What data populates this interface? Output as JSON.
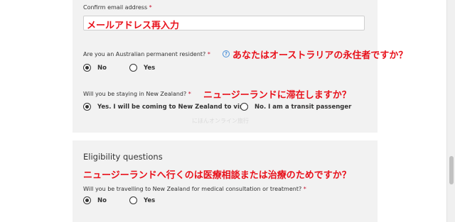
{
  "form": {
    "confirm_email": {
      "label": "Confirm email address",
      "required_mark": "*",
      "value": "メールアドレス再入力"
    },
    "pr_question": {
      "label": "Are you an Australian permanent resident?",
      "required_mark": "*",
      "help_icon": "?",
      "translation": "あなたはオーストラリアの永住者ですか？",
      "options": [
        {
          "label": "No",
          "selected": true
        },
        {
          "label": "Yes",
          "selected": false
        }
      ]
    },
    "stay_question": {
      "label": "Will you be staying in New Zealand?",
      "required_mark": "*",
      "translation": "ニュージーランドに滞在しますか？",
      "options": [
        {
          "label": "Yes. I will be coming to New Zealand to visit",
          "selected": true
        },
        {
          "label": "No. I am a transit passenger",
          "selected": false
        }
      ]
    },
    "watermark": "にほんオンライン旅行"
  },
  "eligibility": {
    "title": "Eligibility questions",
    "translation": "ニュージーランドへ行くのは医療相談または治療のためですか？",
    "medical_question": {
      "label": "Will you be travelling to New Zealand for medical consultation or treatment?",
      "required_mark": "*",
      "options": [
        {
          "label": "No",
          "selected": true
        },
        {
          "label": "Yes",
          "selected": false
        }
      ]
    }
  },
  "colors": {
    "panel_bg": "#f2f2f2",
    "annotation_red": "#e8101a",
    "required_red": "#c8102e",
    "help_blue": "#4a90d9"
  }
}
